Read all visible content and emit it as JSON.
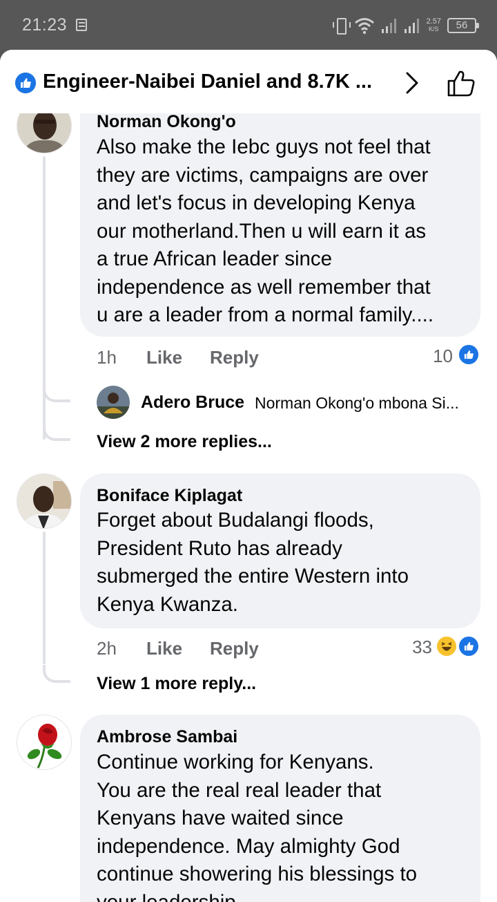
{
  "status_bar": {
    "time": "21:23",
    "net_speed_value": "2.57",
    "net_speed_unit": "K/S",
    "battery": "56"
  },
  "header": {
    "title": "Engineer-Naibei Daniel and 8.7K ...",
    "accent_color": "#1b74e4"
  },
  "comments": [
    {
      "author": "Norman Okong'o",
      "lines": [
        "Also make the Iebc guys not feel that",
        "they are victims, campaigns are over",
        "and let's focus in developing Kenya",
        "our motherland.Then u will earn it as",
        "a true African leader since",
        "independence as well remember that",
        "u are a leader from a normal family...."
      ],
      "time": "1h",
      "like": "Like",
      "reply": "Reply",
      "reaction_count": "10",
      "reply_preview": {
        "name": "Adero Bruce",
        "text": "Norman Okong'o mbona Si..."
      },
      "view_more": "View 2 more replies..."
    },
    {
      "author": "Boniface Kiplagat",
      "lines": [
        "Forget about Budalangi floods,",
        "President Ruto has already",
        "submerged the entire Western into",
        "Kenya Kwanza."
      ],
      "time": "2h",
      "like": "Like",
      "reply": "Reply",
      "reaction_count": "33",
      "view_more": "View 1 more reply..."
    },
    {
      "author": "Ambrose Sambai",
      "lines": [
        "Continue working for Kenyans.",
        "You are the real real leader that",
        "Kenyans have waited since",
        "independence. May almighty God",
        "continue showering his blessings to",
        "your leadership."
      ]
    }
  ]
}
